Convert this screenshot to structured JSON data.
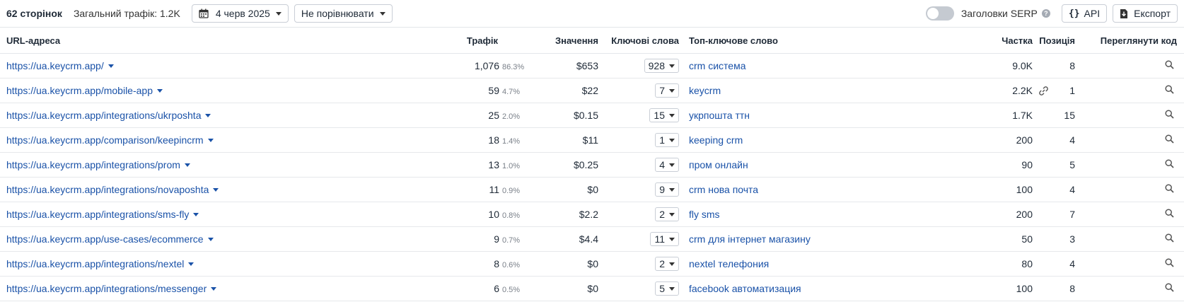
{
  "toolbar": {
    "pages_count": "62 сторінок",
    "total_traffic": "Загальний трафік: 1.2K",
    "date_label": "4 черв 2025",
    "compare_label": "Не порівнювати",
    "serp_toggle_label": "Заголовки SERP",
    "help_icon": "?",
    "api_label": "API",
    "export_label": "Експорт"
  },
  "table": {
    "columns": {
      "url": "URL-адреса",
      "traffic": "Трафік",
      "value": "Значення",
      "keywords": "Ключові слова",
      "top_keyword": "Топ-ключове слово",
      "share": "Частка",
      "position": "Позиція",
      "view_code": "Переглянути код"
    },
    "rows": [
      {
        "url": "https://ua.keycrm.app/",
        "traffic": "1,076",
        "traffic_pct": "86.3%",
        "value": "$653",
        "keywords": "928",
        "top_keyword": "crm система",
        "share": "9.0K",
        "position": "8",
        "has_link_icon": false
      },
      {
        "url": "https://ua.keycrm.app/mobile-app",
        "traffic": "59",
        "traffic_pct": "4.7%",
        "value": "$22",
        "keywords": "7",
        "top_keyword": "keycrm",
        "share": "2.2K",
        "position": "1",
        "has_link_icon": true
      },
      {
        "url": "https://ua.keycrm.app/integrations/ukrposhta",
        "traffic": "25",
        "traffic_pct": "2.0%",
        "value": "$0.15",
        "keywords": "15",
        "top_keyword": "укрпошта ттн",
        "share": "1.7K",
        "position": "15",
        "has_link_icon": false
      },
      {
        "url": "https://ua.keycrm.app/comparison/keepincrm",
        "traffic": "18",
        "traffic_pct": "1.4%",
        "value": "$11",
        "keywords": "1",
        "top_keyword": "keeping crm",
        "share": "200",
        "position": "4",
        "has_link_icon": false
      },
      {
        "url": "https://ua.keycrm.app/integrations/prom",
        "traffic": "13",
        "traffic_pct": "1.0%",
        "value": "$0.25",
        "keywords": "4",
        "top_keyword": "пром онлайн",
        "share": "90",
        "position": "5",
        "has_link_icon": false
      },
      {
        "url": "https://ua.keycrm.app/integrations/novaposhta",
        "traffic": "11",
        "traffic_pct": "0.9%",
        "value": "$0",
        "keywords": "9",
        "top_keyword": "crm нова почта",
        "share": "100",
        "position": "4",
        "has_link_icon": false
      },
      {
        "url": "https://ua.keycrm.app/integrations/sms-fly",
        "traffic": "10",
        "traffic_pct": "0.8%",
        "value": "$2.2",
        "keywords": "2",
        "top_keyword": "fly sms",
        "share": "200",
        "position": "7",
        "has_link_icon": false
      },
      {
        "url": "https://ua.keycrm.app/use-cases/ecommerce",
        "traffic": "9",
        "traffic_pct": "0.7%",
        "value": "$4.4",
        "keywords": "11",
        "top_keyword": "crm для інтернет магазину",
        "share": "50",
        "position": "3",
        "has_link_icon": false
      },
      {
        "url": "https://ua.keycrm.app/integrations/nextel",
        "traffic": "8",
        "traffic_pct": "0.6%",
        "value": "$0",
        "keywords": "2",
        "top_keyword": "nextel телефония",
        "share": "80",
        "position": "4",
        "has_link_icon": false
      },
      {
        "url": "https://ua.keycrm.app/integrations/messenger",
        "traffic": "6",
        "traffic_pct": "0.5%",
        "value": "$0",
        "keywords": "5",
        "top_keyword": "facebook автоматизация",
        "share": "100",
        "position": "8",
        "has_link_icon": false
      }
    ]
  },
  "icons": {
    "calendar": "calendar-icon",
    "api": "code-braces-icon",
    "export": "download-icon",
    "row_view": "search-icon",
    "row_link": "link-icon",
    "caret": "caret-down-icon"
  },
  "colors": {
    "link": "#1a52a8",
    "toggle_off": "#c5cad1",
    "border": "#c9ced6",
    "muted": "#7a8089"
  }
}
